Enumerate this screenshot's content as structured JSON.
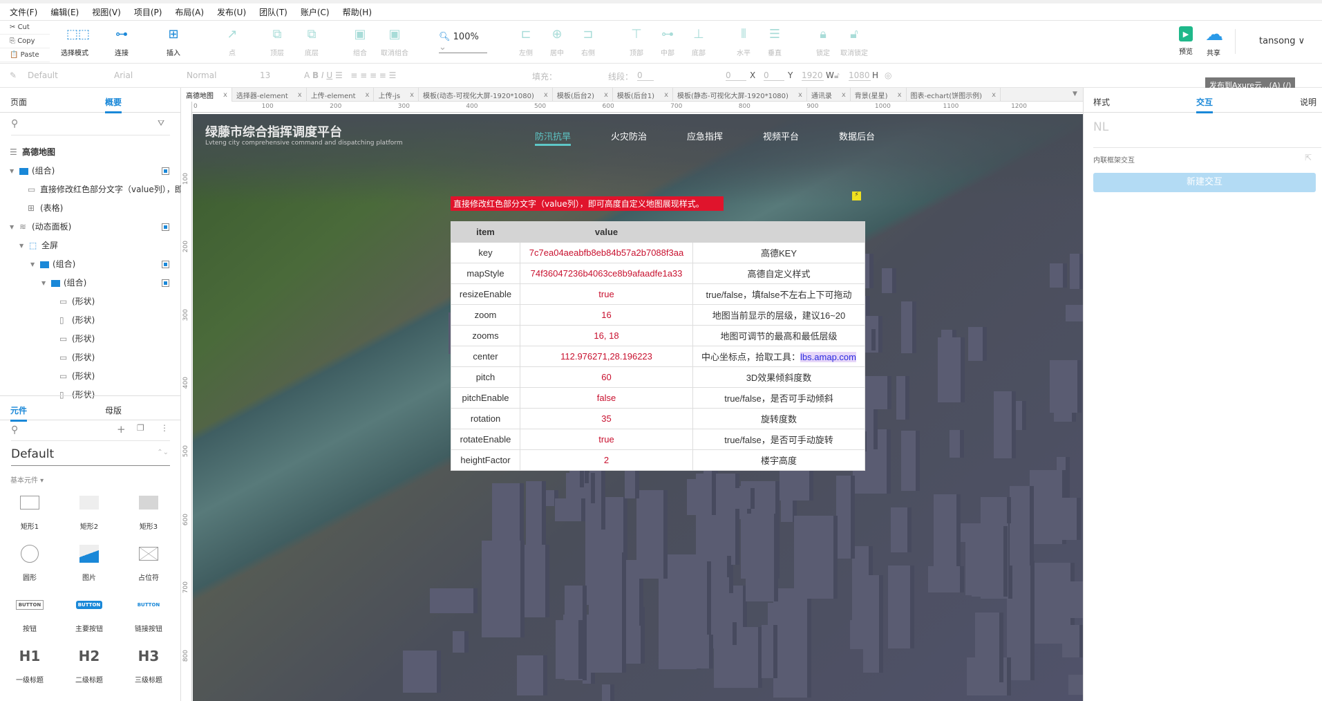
{
  "menu": [
    "文件(F)",
    "编辑(E)",
    "视图(V)",
    "项目(P)",
    "布局(A)",
    "发布(U)",
    "团队(T)",
    "账户(C)",
    "帮助(H)"
  ],
  "clipboard": {
    "cut": "Cut",
    "copy": "Copy",
    "paste": "Paste"
  },
  "toolbar": {
    "select_mode": "选择模式",
    "connect": "连接",
    "insert": "插入",
    "point": "点",
    "top_layer": "顶层",
    "bottom_layer": "底层",
    "group": "组合",
    "ungroup": "取消组合",
    "zoom": "100%",
    "align_left": "左侧",
    "align_center": "居中",
    "align_right": "右侧",
    "align_top": "顶部",
    "align_middle": "中部",
    "align_bottom": "底部",
    "dist_h": "水平",
    "dist_v": "垂直",
    "lock": "锁定",
    "unlock": "取消锁定",
    "preview": "预览",
    "share": "共享",
    "user": "tansong"
  },
  "format": {
    "style": "Default",
    "font": "Arial",
    "weight": "Normal",
    "size": "13",
    "fill_label": "填充：",
    "line_label": "线段：",
    "line_value": "0",
    "x": "0",
    "x_label": "X",
    "y": "0",
    "y_label": "Y",
    "w": "1920",
    "w_label": "W",
    "h": "1080",
    "h_label": "H"
  },
  "tooltip": "发布到Axure云...(A) (/)",
  "left": {
    "tabs": [
      "页面",
      "概要"
    ],
    "active_tab": 1,
    "tree": [
      {
        "label": "高德地图",
        "bold": true
      },
      {
        "label": "(组合)"
      },
      {
        "label": "直接修改红色部分文字（value列），即可高度自定义地图展现样式。"
      },
      {
        "label": "(表格)"
      },
      {
        "label": "(动态面板)"
      },
      {
        "label": "全屏"
      },
      {
        "label": "(组合)"
      },
      {
        "label": "(组合)"
      },
      {
        "label": "(形状)"
      },
      {
        "label": "(形状)"
      },
      {
        "label": "(形状)"
      },
      {
        "label": "(形状)"
      },
      {
        "label": "(形状)"
      },
      {
        "label": "(形状)"
      }
    ],
    "lib_tabs": [
      "元件",
      "母版"
    ],
    "library": "Default",
    "category": "基本元件 ▾",
    "components": [
      "矩形1",
      "矩形2",
      "矩形3",
      "圆形",
      "图片",
      "占位符",
      "按钮",
      "主要按钮",
      "链接按钮",
      "一级标题",
      "二级标题",
      "三级标题"
    ],
    "button_text": "BUTTON",
    "headings": [
      "H1",
      "H2",
      "H3"
    ]
  },
  "doc_tabs": [
    "高德地图",
    "选择器-element",
    "上传-element",
    "上传-js",
    "模板(动态-可视化大屏-1920*1080)",
    "模板(后台2)",
    "模板(后台1)",
    "模板(静态-可视化大屏-1920*1080)",
    "通讯录",
    "背景(星星)",
    "图表-echart(饼图示例)"
  ],
  "ruler_h": [
    "0",
    "100",
    "200",
    "300",
    "400",
    "500",
    "600",
    "700",
    "800",
    "900",
    "1000",
    "1100",
    "1200"
  ],
  "ruler_v": [
    "100",
    "200",
    "300",
    "400",
    "500",
    "600",
    "700",
    "800"
  ],
  "canvas": {
    "title": "绿藤市综合指挥调度平台",
    "subtitle": "Lvteng city comprehensive command and dispatching platform",
    "nav": [
      "防汛抗旱",
      "火灾防治",
      "应急指挥",
      "视频平台",
      "数据后台"
    ],
    "nav_active": 0,
    "banner": "直接修改红色部分文字（value列），即可高度自定义地图展现样式。",
    "table": {
      "headers": [
        "item",
        "value",
        ""
      ],
      "rows": [
        [
          "key",
          "7c7ea04aeabfb8eb84b57a2b7088f3aa",
          "高德KEY"
        ],
        [
          "mapStyle",
          "74f36047236b4063ce8b9afaadfe1a33",
          "高德自定义样式"
        ],
        [
          "resizeEnable",
          "true",
          "true/false，填false不左右上下可拖动"
        ],
        [
          "zoom",
          "16",
          "地图当前显示的层级，建议16~20"
        ],
        [
          "zooms",
          "16, 18",
          "地图可调节的最高和最低层级"
        ],
        [
          "center",
          "112.976271,28.196223",
          "中心坐标点，拾取工具："
        ],
        [
          "pitch",
          "60",
          "3D效果倾斜度数"
        ],
        [
          "pitchEnable",
          "false",
          "true/false，是否可手动倾斜"
        ],
        [
          "rotation",
          "35",
          "旋转度数"
        ],
        [
          "rotateEnable",
          "true",
          "true/false，是否可手动旋转"
        ],
        [
          "heightFactor",
          "2",
          "楼宇高度"
        ]
      ],
      "link": "lbs.amap.com"
    }
  },
  "right": {
    "tabs": [
      "样式",
      "交互",
      "说明"
    ],
    "active_tab": 1,
    "name_placeholder": "NL",
    "inline_label": "内联框架交互",
    "new_interaction": "新建交互"
  },
  "colors": {
    "accent": "#1a88d8",
    "value_red": "#c8102e",
    "banner_red": "#e0142c",
    "nav_active": "#5ec8c8"
  }
}
